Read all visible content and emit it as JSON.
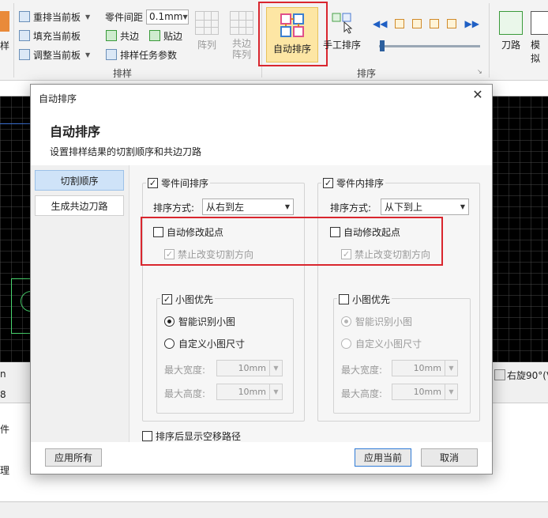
{
  "ribbon": {
    "partial_left_label": "样",
    "arrange": {
      "reorder_current": "重排当前板",
      "fill_current": "填充当前板",
      "adjust_current": "调整当前板"
    },
    "spacing": {
      "label": "零件间距",
      "value": "0.1mm"
    },
    "common_edge": "共边",
    "attach_edge": "贴边",
    "task_params": "排样任务参数",
    "array_button": "阵列",
    "common_edge_array": "共边\n阵列",
    "group_nesting": "排样",
    "auto_sort": "自动排序",
    "manual_sort": "手工排序",
    "group_sort": "排序",
    "tool_path": "刀路",
    "partial_right_label": "模拟"
  },
  "background": {
    "status_left": "n",
    "status_right": "右旋90°(V",
    "status_left2": "8",
    "panel_text1": "件",
    "panel_text2": "理"
  },
  "dialog": {
    "title": "自动排序",
    "heading": "自动排序",
    "subtitle": "设置排样结果的切割顺序和共边刀路",
    "nav": {
      "cut_order": "切割顺序",
      "gen_common_edge": "生成共边刀路"
    },
    "left": {
      "between_parts_label": "零件间排序",
      "between_parts_checked": true,
      "sort_mode_label": "排序方式:",
      "sort_mode_value": "从右到左",
      "auto_modify_start": "自动修改起点",
      "forbid_change_dir": "禁止改变切割方向",
      "small_first": "小图优先",
      "smart_detect": "智能识别小图",
      "custom_size": "自定义小图尺寸",
      "max_width_label": "最大宽度:",
      "max_width_value": "10mm",
      "max_height_label": "最大高度:",
      "max_height_value": "10mm"
    },
    "right": {
      "inside_parts_label": "零件内排序",
      "inside_parts_checked": true,
      "sort_mode_label": "排序方式:",
      "sort_mode_value": "从下到上",
      "auto_modify_start": "自动修改起点",
      "forbid_change_dir": "禁止改变切割方向",
      "small_first": "小图优先",
      "smart_detect": "智能识别小图",
      "custom_size": "自定义小图尺寸",
      "max_width_label": "最大宽度:",
      "max_width_value": "10mm",
      "max_height_label": "最大高度:",
      "max_height_value": "10mm"
    },
    "show_empty_path": "排序后显示空移路径",
    "apply_all": "应用所有",
    "apply_current": "应用当前",
    "cancel": "取消"
  },
  "colors": {
    "highlight": "#d9262e",
    "accent_selected": "#fde6a4",
    "nav_active": "#cfe3f8"
  }
}
